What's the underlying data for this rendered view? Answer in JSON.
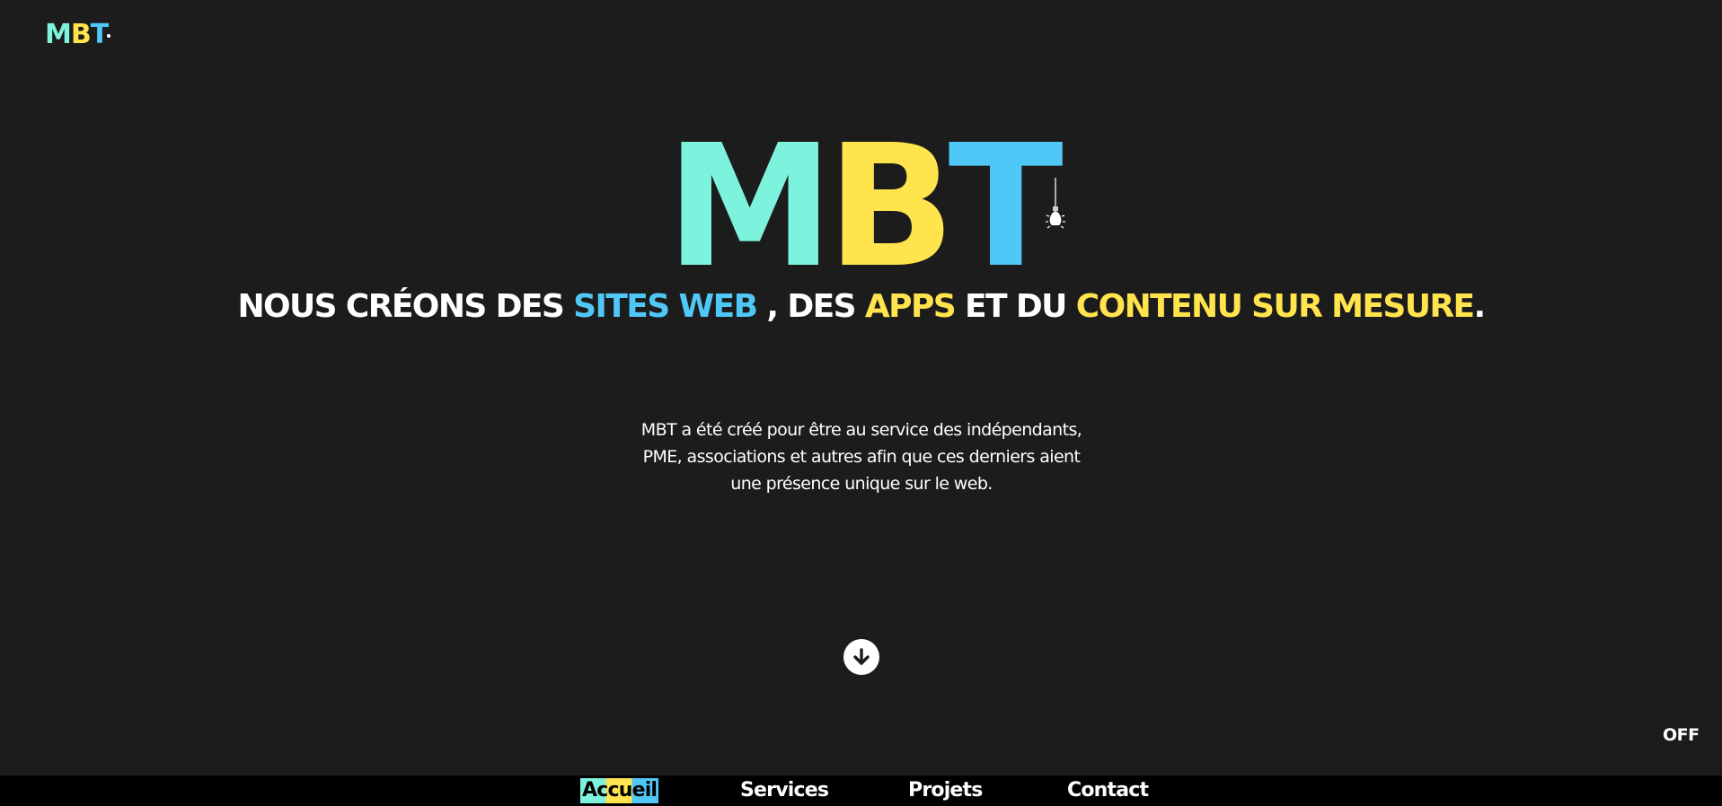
{
  "corner_logo": {
    "m": "M",
    "b": "B",
    "t": "T"
  },
  "hero": {
    "logo": {
      "m": "M",
      "b": "B",
      "t": "T"
    },
    "tagline": {
      "part1": "NOUS CRÉONS DES ",
      "sites_web": "SITES WEB",
      "part2": " , DES ",
      "apps": "APPS",
      "part3": " ET DU ",
      "contenu": "CONTENU SUR MESURE",
      "part4": "."
    },
    "intro": "MBT a été créé pour être au service des indépendants, PME, associations et autres afin que ces derniers aient une présence unique sur le web."
  },
  "scroll_icon": "arrow-down-icon",
  "toggle_label": "OFF",
  "nav": {
    "items": [
      {
        "label": "Accueil",
        "active": true
      },
      {
        "label": "Services",
        "active": false
      },
      {
        "label": "Projets",
        "active": false
      },
      {
        "label": "Contact",
        "active": false
      }
    ]
  },
  "colors": {
    "background": "#1c1c1c",
    "turquoise": "#7df2dd",
    "yellow": "#ffe44d",
    "blue": "#4fc8f7",
    "nav_background": "#000000"
  }
}
